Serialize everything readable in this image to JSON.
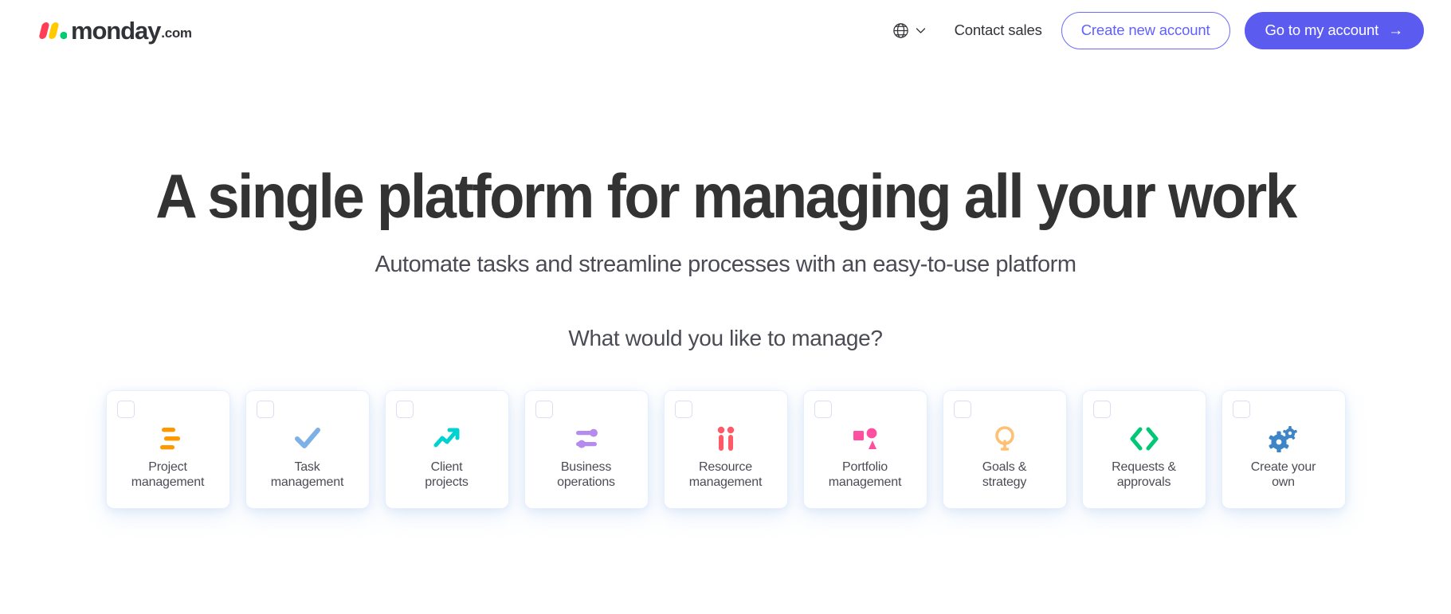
{
  "header": {
    "logo": {
      "name": "monday",
      "tld": ".com",
      "colors": {
        "pink": "#ff3d57",
        "yellow": "#ffcb00",
        "green": "#00ca72"
      }
    },
    "language_switcher": {
      "icon": "globe-icon",
      "chevron": "chevron-down-icon"
    },
    "contact_sales": "Contact sales",
    "create_account": "Create new account",
    "go_to_account": "Go to my account",
    "go_to_account_arrow": "→",
    "accent_primary": "#5b5bef",
    "accent_outline": "#6161ff"
  },
  "hero": {
    "headline": "A single platform for managing all your work",
    "subheadline": "Automate tasks and streamline processes with an easy-to-use platform",
    "question": "What would you like to manage?"
  },
  "cards": [
    {
      "id": "project-management",
      "label": "Project\nmanagement",
      "icon": "bar-chart-icon",
      "color": "#ff9900"
    },
    {
      "id": "task-management",
      "label": "Task\nmanagement",
      "icon": "checkmark-icon",
      "color": "#7eb0e8"
    },
    {
      "id": "client-projects",
      "label": "Client\nprojects",
      "icon": "trending-up-icon",
      "color": "#00d2d2"
    },
    {
      "id": "business-operations",
      "label": "Business\noperations",
      "icon": "sliders-icon",
      "color": "#b58bee"
    },
    {
      "id": "resource-management",
      "label": "Resource\nmanagement",
      "icon": "people-icon",
      "color": "#ff5a67"
    },
    {
      "id": "portfolio-management",
      "label": "Portfolio\nmanagement",
      "icon": "shapes-icon",
      "color": "#ff4fa0"
    },
    {
      "id": "goals-strategy",
      "label": "Goals &\nstrategy",
      "icon": "lightbulb-icon",
      "color": "#ffc073"
    },
    {
      "id": "requests-approvals",
      "label": "Requests &\napprovals",
      "icon": "code-brackets-icon",
      "color": "#00c875"
    },
    {
      "id": "create-your-own",
      "label": "Create your\nown",
      "icon": "gears-icon",
      "color": "#3d85c6"
    }
  ]
}
